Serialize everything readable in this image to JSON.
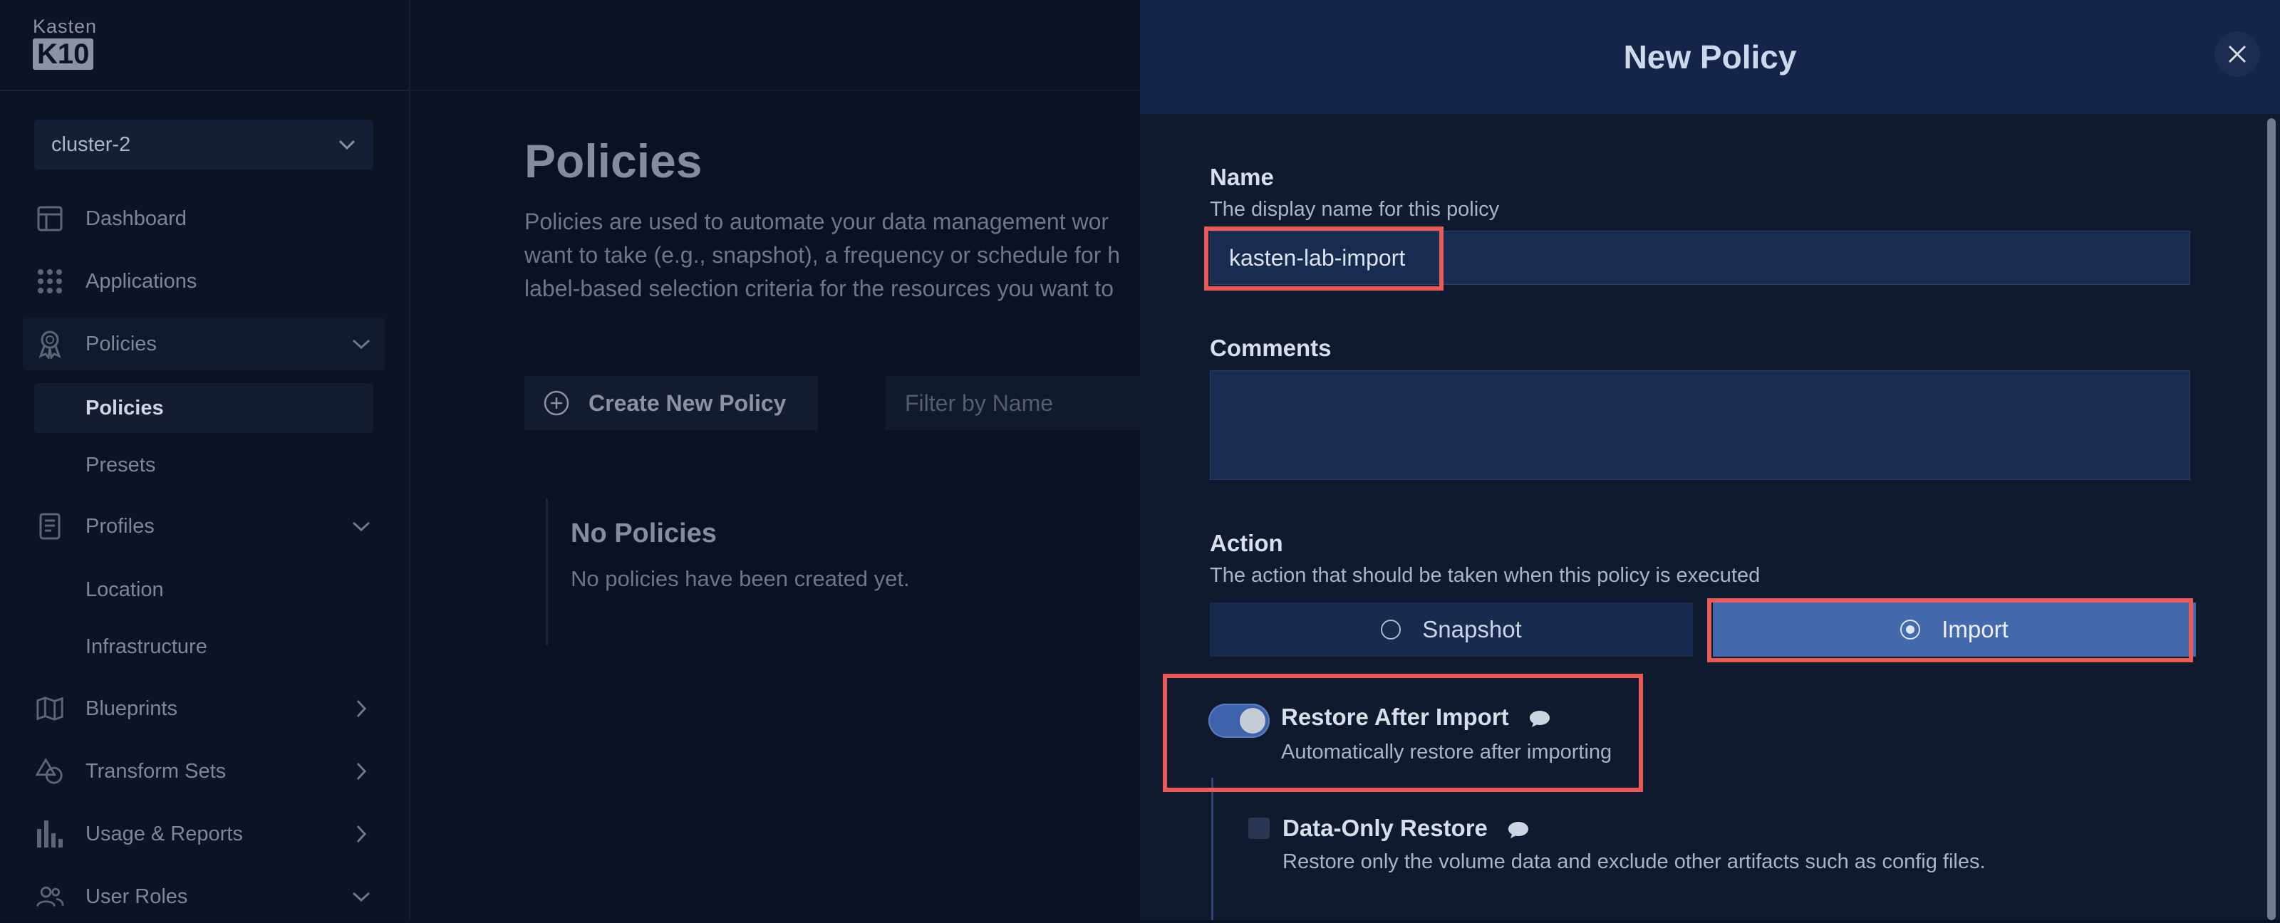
{
  "app": {
    "logo_top": "Kasten",
    "logo_bottom": "K10"
  },
  "sidebar": {
    "cluster": "cluster-2",
    "items": [
      {
        "label": "Dashboard",
        "icon": "dashboard-icon"
      },
      {
        "label": "Applications",
        "icon": "applications-grid-icon"
      },
      {
        "label": "Policies",
        "icon": "policies-ribbon-icon",
        "sub": [
          "Policies",
          "Presets"
        ]
      },
      {
        "label": "Profiles",
        "icon": "profiles-document-icon",
        "sub": [
          "Location",
          "Infrastructure"
        ]
      },
      {
        "label": "Blueprints",
        "icon": "blueprints-map-icon"
      },
      {
        "label": "Transform Sets",
        "icon": "transform-sets-shapes-icon"
      },
      {
        "label": "Usage & Reports",
        "icon": "usage-bar-chart-icon"
      },
      {
        "label": "User Roles",
        "icon": "user-roles-icon"
      }
    ]
  },
  "main": {
    "title": "Policies",
    "description": [
      "Policies are used to automate your data management wor",
      "want to take (e.g., snapshot), a frequency or schedule for h",
      "label-based selection criteria for the resources you want to"
    ],
    "create_button": "Create New Policy",
    "filter_placeholder": "Filter by Name",
    "empty_title": "No Policies",
    "empty_desc": "No policies have been created yet."
  },
  "modal": {
    "title": "New Policy",
    "name_label": "Name",
    "name_help": "The display name for this policy",
    "name_value": "kasten-lab-import",
    "comments_label": "Comments",
    "comments_value": "",
    "action_label": "Action",
    "action_help": "The action that should be taken when this policy is executed",
    "action_options": [
      "Snapshot",
      "Import"
    ],
    "action_selected": "Import",
    "restore_label": "Restore After Import",
    "restore_help": "Automatically restore after importing",
    "restore_enabled": true,
    "data_only_label": "Data-Only Restore",
    "data_only_help": "Restore only the volume data and exclude other artifacts such as config files.",
    "data_only_checked": false
  },
  "colors": {
    "background": "#0a1120",
    "modal_header": "#142549",
    "selected_action": "#4469ad",
    "highlight": "#ea5b57"
  }
}
